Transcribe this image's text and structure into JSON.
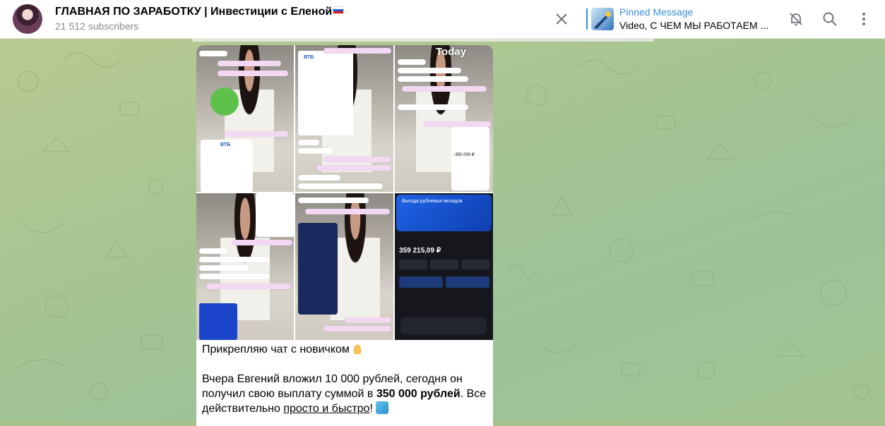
{
  "header": {
    "channel_title": "ГЛАВНАЯ ПО ЗАРАБОТКУ | Инвестиции с Еленой",
    "subscribers": "21 512 subscribers",
    "pinned_label": "Pinned Message",
    "pinned_text": "Video, С ЧЕМ МЫ РАБОТАЕМ ..."
  },
  "icons": [
    "close-icon",
    "pin-thumbnail",
    "mute-bell-icon",
    "search-icon",
    "more-vertical-icon"
  ],
  "post": {
    "media_date_badge": "Today",
    "line1": "Прикрепляю чат с новичком",
    "line2_prefix": "Вчера Евгений вложил 10 000 рублей,  сегодня он получил свою выплату суммой в ",
    "line2_bold": "350 000 рублей",
    "line2_mid": ". Все действительно ",
    "line2_underlined": "просто и быстро",
    "line2_end": "!"
  },
  "media": {
    "bank_logo": "ВТБ",
    "balance": "359 215,09 ₽",
    "amount_card": "−350 000 ₽",
    "banner_title": "Выгода рублевых вкладов"
  },
  "colors": {
    "accent": "#3a8fd6",
    "wallpaper": "#a6c492",
    "header_bg": "#ffffff"
  }
}
